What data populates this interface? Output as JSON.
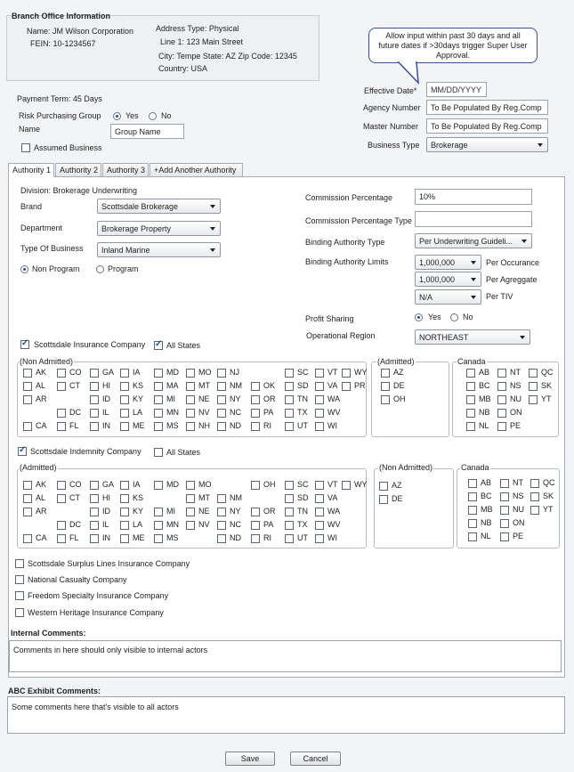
{
  "branch_office": {
    "title": "Branch Office Information",
    "name": "Name: JM Wilson Corporation",
    "fein": "FEIN: 10-1234567",
    "address_type": "Address Type: Physical",
    "line1": "Line 1: 123 Main Street",
    "city_line": "City: Tempe  State: AZ  Zip Code: 12345",
    "country": "Country: USA"
  },
  "tooltip": "Allow input within past 30 days and all future dates if >30days trigger Super User Approval.",
  "payment_term": "Payment Term: 45 Days",
  "risk_purchasing_group": {
    "label": "Risk Purchasing Group",
    "yes": "Yes",
    "no": "No",
    "selected": "Yes"
  },
  "name_field": {
    "label": "Name",
    "value": "Group Name"
  },
  "assumed_business": {
    "label": "Assumed Business",
    "checked": false
  },
  "effective_date": {
    "label": "Effective Date*",
    "placeholder": "MM/DD/YYYY"
  },
  "agency_number": {
    "label": "Agency Number",
    "value": "To Be Populated By Reg.Comp"
  },
  "master_number": {
    "label": "Master Number",
    "value": "To Be Populated By Reg.Comp"
  },
  "business_type": {
    "label": "Business Type",
    "value": "Brokerage"
  },
  "tabs": [
    "Authority 1",
    "Authority 2",
    "Authority 3",
    "+Add Another Authority"
  ],
  "authority": {
    "division": "Division: Brokerage Underwriting",
    "brand_label": "Brand",
    "brand_value": "Scottsdale Brokerage",
    "department_label": "Department",
    "department_value": "Brokerage Property",
    "type_of_business_label": "Type Of Business",
    "type_of_business_value": "Inland Marine",
    "non_program": "Non Program",
    "program": "Program",
    "commission_percentage_label": "Commission Percentage",
    "commission_percentage_value": "10%",
    "commission_percentage_type_label": "Commission  Percentage Type",
    "binding_authority_type_label": "Binding Authority Type",
    "binding_authority_type_value": "Per Underwriting Guideli...",
    "binding_authority_limits_label": "Binding Authority Limits",
    "limit1_value": "1,000,000",
    "limit1_label": "Per Occurance",
    "limit2_value": "1,000,000",
    "limit2_label": "Per Agreggate",
    "limit3_value": "N/A",
    "limit3_label": "Per TIV",
    "profit_sharing_label": "Profit Sharing",
    "profit_yes": "Yes",
    "profit_no": "No",
    "operational_region_label": "Operational Region",
    "operational_region_value": "NORTHEAST"
  },
  "company1": {
    "name": "Scottsdale Insurance Company",
    "all_states": "All States",
    "group1_title": "(Non Admitted)",
    "group2_title": "(Admitted)",
    "group3_title": "Canada"
  },
  "company2": {
    "name": "Scottsdale Indemnity Company",
    "all_states": "All States",
    "group1_title": "(Admitted)",
    "group2_title": "(Non Admitted)",
    "group3_title": "Canada"
  },
  "other_companies": [
    "Scottsdale Surplus Lines Insurance Company",
    "National Casualty Company",
    "Freedom Specialty Insurance Company",
    "Western Heritage Insurance Company"
  ],
  "internal_comments": {
    "label": "Internal Comments:",
    "value": "Comments in here should only visible to internal actors"
  },
  "abc_comments": {
    "label": "ABC Exhibit Comments:",
    "value": "Some comments here that's visible to all actors"
  },
  "buttons": {
    "save": "Save",
    "cancel": "Cancel"
  },
  "colors": {
    "accent": "#1d4fa0",
    "panel": "#eef0f3",
    "border": "#b7bcc4"
  },
  "states_grid_1": [
    [
      "AK",
      "CO",
      "GA",
      "IA",
      "MD",
      "MO",
      "NJ",
      "",
      "SC",
      "VT",
      "WY"
    ],
    [
      "AL",
      "CT",
      "HI",
      "KS",
      "MA",
      "MT",
      "NM",
      "OK",
      "SD",
      "VA",
      "PR"
    ],
    [
      "AR",
      "",
      "ID",
      "KY",
      "MI",
      "NE",
      "NY",
      "OR",
      "TN",
      "WA",
      ""
    ],
    [
      "",
      "DC",
      "IL",
      "LA",
      "MN",
      "NV",
      "NC",
      "PA",
      "TX",
      "WV",
      ""
    ],
    [
      "CA",
      "FL",
      "IN",
      "ME",
      "MS",
      "NH",
      "ND",
      "RI",
      "UT",
      "WI",
      ""
    ]
  ],
  "states_admitted_1": [
    "AZ",
    "DE",
    "OH"
  ],
  "canada_1": [
    [
      "AB",
      "NT",
      "QC"
    ],
    [
      "BC",
      "NS",
      "SK"
    ],
    [
      "MB",
      "NU",
      "YT"
    ],
    [
      "NB",
      "ON",
      ""
    ],
    [
      "NL",
      "PE",
      ""
    ]
  ],
  "states_grid_2": [
    [
      "AK",
      "CO",
      "GA",
      "IA",
      "MD",
      "MO",
      "",
      "OH",
      "SC",
      "VT",
      "WY"
    ],
    [
      "AL",
      "CT",
      "HI",
      "KS",
      "",
      "MT",
      "NM",
      "",
      "SD",
      "VA",
      ""
    ],
    [
      "AR",
      "",
      "ID",
      "KY",
      "MI",
      "NE",
      "NY",
      "OR",
      "TN",
      "WA",
      ""
    ],
    [
      "",
      "DC",
      "IL",
      "LA",
      "MN",
      "NV",
      "NC",
      "PA",
      "TX",
      "WV",
      ""
    ],
    [
      "CA",
      "FL",
      "IN",
      "ME",
      "MS",
      "",
      "ND",
      "RI",
      "UT",
      "WI",
      ""
    ]
  ],
  "states_nonadmitted_2": [
    "AZ",
    "DE"
  ],
  "canada_2": [
    [
      "AB",
      "NT",
      "QC"
    ],
    [
      "BC",
      "NS",
      "SK"
    ],
    [
      "MB",
      "NU",
      "YT"
    ],
    [
      "NB",
      "ON",
      ""
    ],
    [
      "NL",
      "PE",
      ""
    ]
  ]
}
